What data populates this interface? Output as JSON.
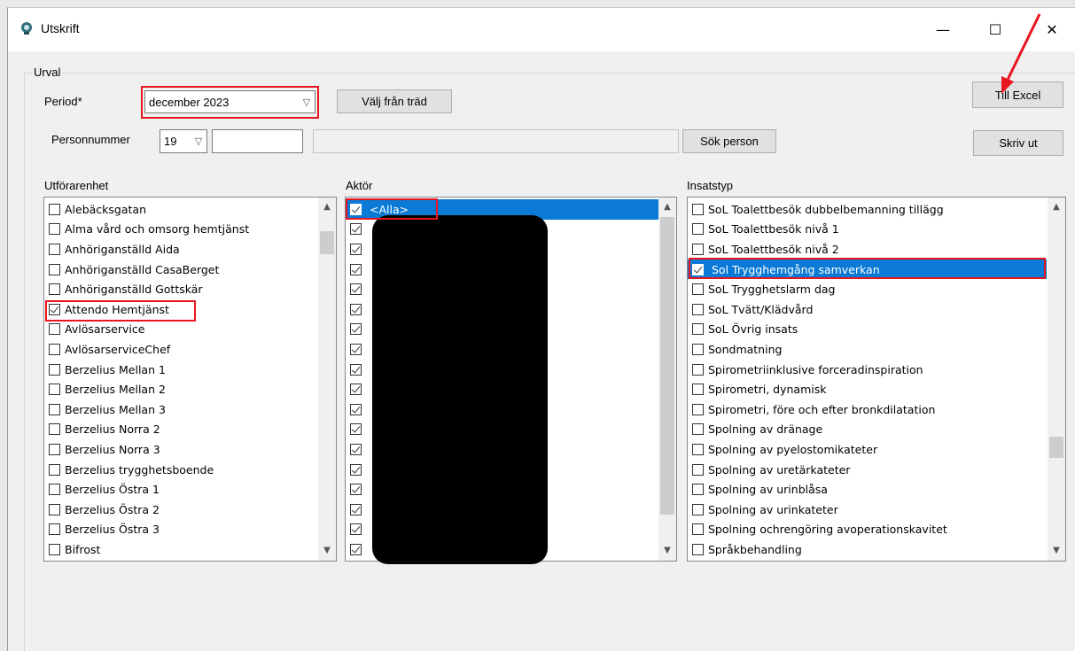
{
  "window": {
    "title": "Utskrift",
    "minimize_glyph": "—",
    "maximize_glyph": "☐",
    "close_glyph": "✕"
  },
  "group": {
    "label": "Urval"
  },
  "period": {
    "label": "Period*",
    "value": "december 2023"
  },
  "tree_button": {
    "label": "Välj från träd"
  },
  "excel_button": {
    "label": "Till Excel"
  },
  "print_button": {
    "label": "Skriv ut"
  },
  "personnummer": {
    "label": "Personnummer",
    "century": "19",
    "number": "",
    "name": ""
  },
  "search_button": {
    "label": "Sök person"
  },
  "utforarenhet": {
    "header": "Utförarenhet",
    "items": [
      {
        "label": "Alebäcksgatan",
        "checked": false
      },
      {
        "label": "Alma vård och omsorg hemtjänst",
        "checked": false
      },
      {
        "label": "Anhöriganställd Aida",
        "checked": false
      },
      {
        "label": "Anhöriganställd CasaBerget",
        "checked": false
      },
      {
        "label": "Anhöriganställd Gottskär",
        "checked": false
      },
      {
        "label": "Attendo Hemtjänst",
        "checked": true
      },
      {
        "label": "Avlösarservice",
        "checked": false
      },
      {
        "label": "AvlösarserviceChef",
        "checked": false
      },
      {
        "label": "Berzelius Mellan 1",
        "checked": false
      },
      {
        "label": "Berzelius Mellan 2",
        "checked": false
      },
      {
        "label": "Berzelius Mellan 3",
        "checked": false
      },
      {
        "label": "Berzelius Norra 2",
        "checked": false
      },
      {
        "label": "Berzelius Norra 3",
        "checked": false
      },
      {
        "label": "Berzelius trygghetsboende",
        "checked": false
      },
      {
        "label": "Berzelius Östra 1",
        "checked": false
      },
      {
        "label": "Berzelius Östra 2",
        "checked": false
      },
      {
        "label": "Berzelius Östra 3",
        "checked": false
      },
      {
        "label": "Bifrost",
        "checked": false
      }
    ]
  },
  "aktor": {
    "header": "Aktör",
    "items": [
      {
        "label": "<Alla>",
        "checked": true,
        "selected": true
      },
      {
        "label": "",
        "checked": true
      },
      {
        "label": "",
        "checked": true
      },
      {
        "label": "",
        "checked": true
      },
      {
        "label": "",
        "checked": true
      },
      {
        "label": "",
        "checked": true
      },
      {
        "label": "",
        "checked": true
      },
      {
        "label": "",
        "checked": true
      },
      {
        "label": "",
        "checked": true
      },
      {
        "label": "",
        "checked": true
      },
      {
        "label": "",
        "checked": true
      },
      {
        "label": "",
        "checked": true
      },
      {
        "label": "",
        "checked": true
      },
      {
        "label": "",
        "checked": true
      },
      {
        "label": "",
        "checked": true
      },
      {
        "label": "",
        "checked": true
      },
      {
        "label": "",
        "checked": true
      },
      {
        "label": "",
        "checked": true
      }
    ]
  },
  "insatstyp": {
    "header": "Insatstyp",
    "items": [
      {
        "label": "SoL Toalettbesök dubbelbemanning tillägg",
        "checked": false
      },
      {
        "label": "SoL Toalettbesök nivå 1",
        "checked": false
      },
      {
        "label": "SoL Toalettbesök nivå 2",
        "checked": false
      },
      {
        "label": "Sol Trygghemgång samverkan",
        "checked": true,
        "selected": true
      },
      {
        "label": "SoL Trygghetslarm dag",
        "checked": false
      },
      {
        "label": "SoL Tvätt/Klädvård",
        "checked": false
      },
      {
        "label": "SoL Övrig insats",
        "checked": false
      },
      {
        "label": "Sondmatning",
        "checked": false
      },
      {
        "label": "Spirometriinklusive forceradinspiration",
        "checked": false
      },
      {
        "label": "Spirometri, dynamisk",
        "checked": false
      },
      {
        "label": "Spirometri, före och efter bronkdilatation",
        "checked": false
      },
      {
        "label": "Spolning av dränage",
        "checked": false
      },
      {
        "label": "Spolning av pyelostomikateter",
        "checked": false
      },
      {
        "label": "Spolning av uretärkateter",
        "checked": false
      },
      {
        "label": "Spolning av urinblåsa",
        "checked": false
      },
      {
        "label": "Spolning av urinkateter",
        "checked": false
      },
      {
        "label": "Spolning ochrengöring avoperationskavitet",
        "checked": false
      },
      {
        "label": "Språkbehandling",
        "checked": false
      }
    ]
  },
  "colors": {
    "highlight": "#e8141e",
    "selection": "#0a7ad6",
    "arrow": "#e8141e"
  }
}
